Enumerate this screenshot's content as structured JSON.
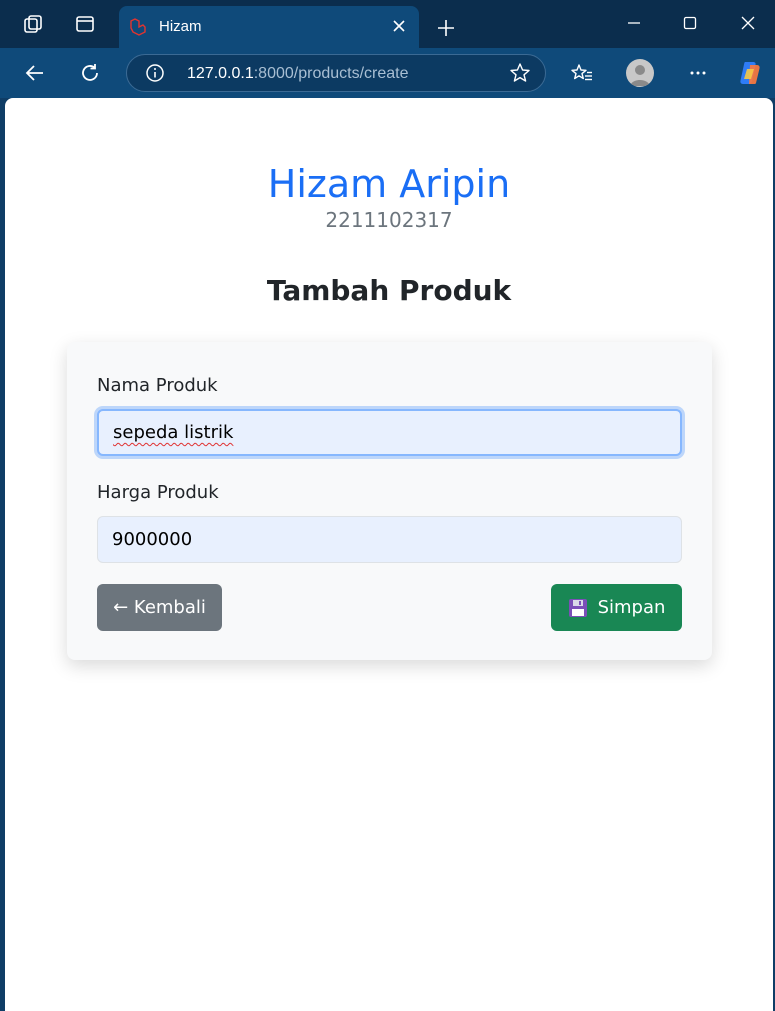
{
  "browser": {
    "tab_title": "Hizam",
    "address_host": "127.0.0.1",
    "address_rest": ":8000/products/create"
  },
  "page": {
    "name": "Hizam Aripin",
    "nim": "2211102317",
    "heading": "Tambah Produk"
  },
  "form": {
    "name_label": "Nama Produk",
    "name_value": "sepeda listrik",
    "price_label": "Harga Produk",
    "price_value": "9000000",
    "back_label": "← Kembali",
    "save_label": "Simpan"
  },
  "colors": {
    "accent": "#1a6ef5",
    "secondary_button": "#6c757d",
    "success_button": "#198754"
  },
  "icons": [
    "workspaces-icon",
    "tab-actions-icon",
    "laravel-icon",
    "close-icon",
    "plus-icon",
    "minimize-icon",
    "maximize-icon",
    "back-icon",
    "refresh-icon",
    "info-icon",
    "star-icon",
    "favorites-icon",
    "more-icon",
    "copilot-icon",
    "floppy-disk-icon"
  ]
}
